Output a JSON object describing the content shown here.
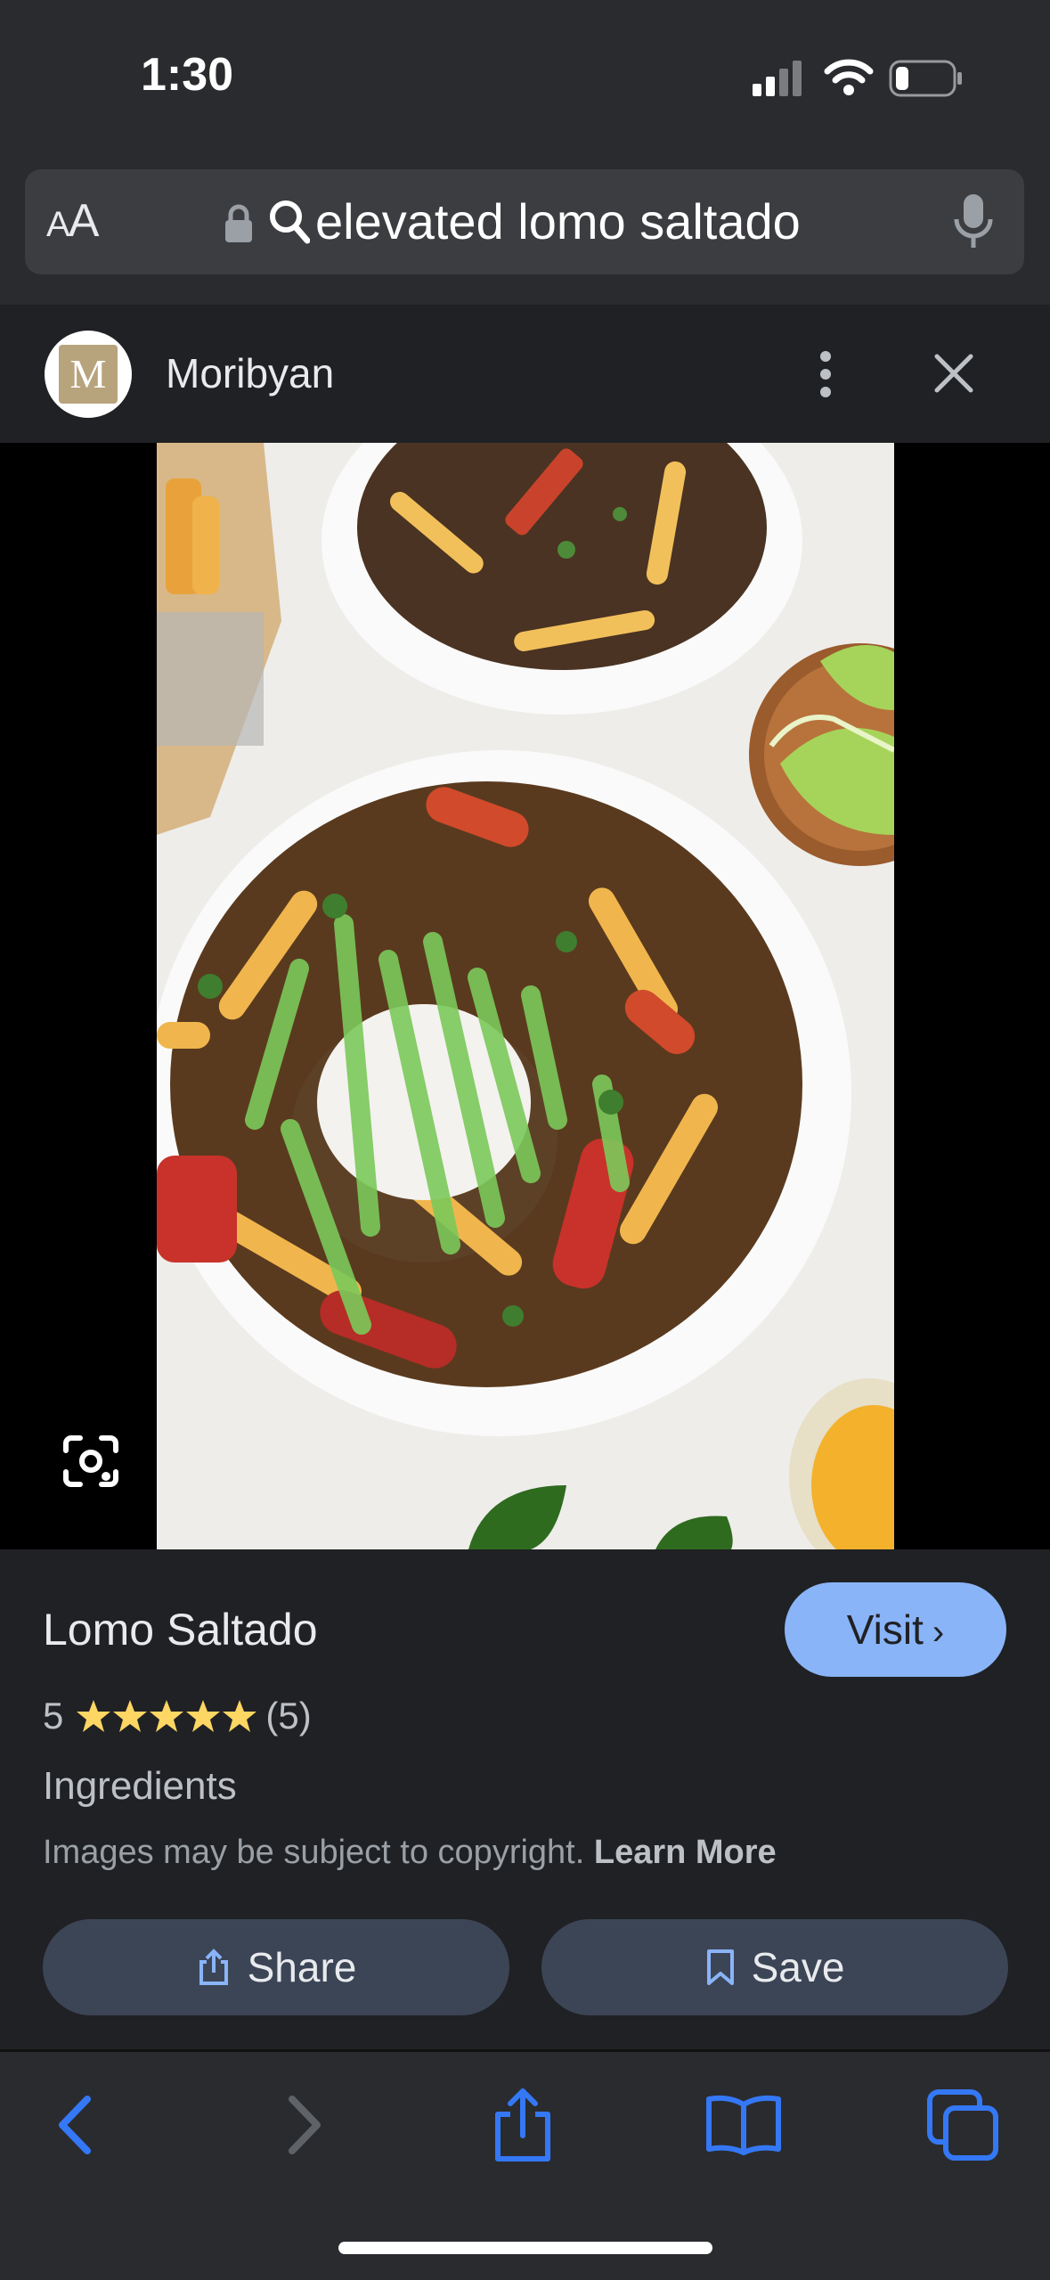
{
  "status": {
    "time": "1:30",
    "signal_icon": "cellular-signal-icon",
    "wifi_icon": "wifi-icon",
    "battery_icon": "battery-icon"
  },
  "urlbar": {
    "aa_big": "A",
    "aa_small": "A",
    "query": "elevated lomo saltado"
  },
  "source": {
    "name": "Moribyan",
    "logo_text": "M"
  },
  "result": {
    "title": "Lomo Saltado",
    "visit_label": "Visit",
    "rating_value": "5",
    "rating_count": "(5)",
    "stars": 5,
    "section_label": "Ingredients",
    "copyright_text": "Images may be subject to copyright.",
    "learn_more": "Learn More",
    "share_label": "Share",
    "save_label": "Save"
  },
  "colors": {
    "accent": "#8ab4f8",
    "star": "#fdd663",
    "safari_blue": "#3478f6"
  }
}
